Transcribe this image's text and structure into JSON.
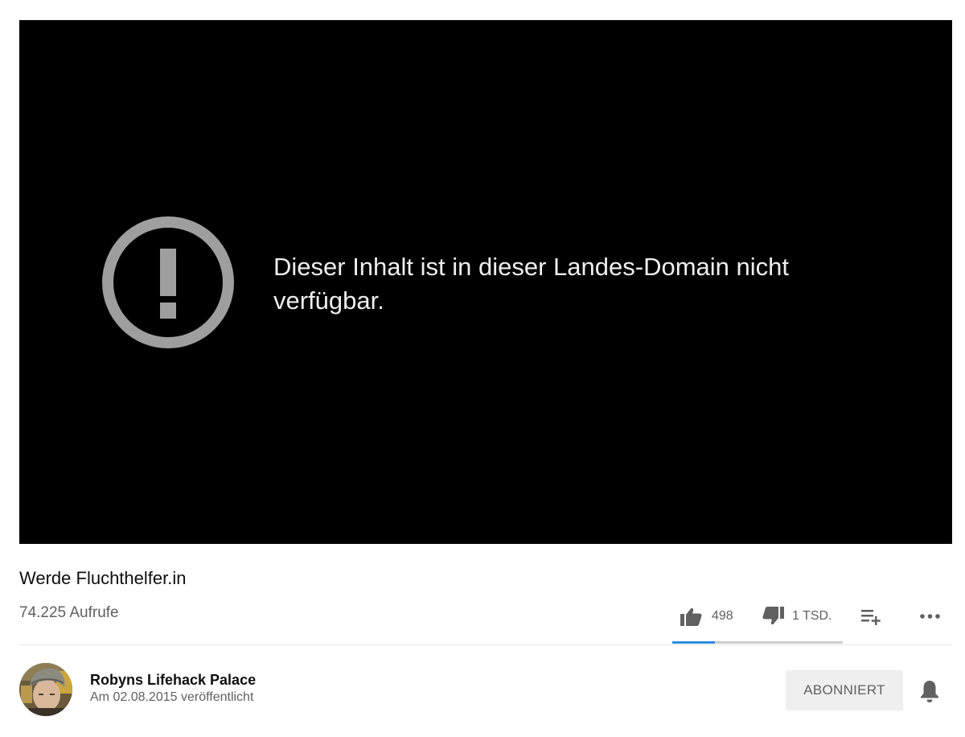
{
  "player": {
    "error_icon": "alert-circle-icon",
    "error_message": "Dieser Inhalt ist in dieser Landes-Domain nicht verfügbar."
  },
  "video": {
    "title": "Werde Fluchthelfer.in",
    "views": "74.225 Aufrufe"
  },
  "actions": {
    "like_icon": "thumbs-up-icon",
    "like_count": "498",
    "dislike_icon": "thumbs-down-icon",
    "dislike_count": "1 TSD.",
    "save_icon": "add-to-playlist-icon",
    "more_icon": "more-horizontal-icon",
    "like_ratio": 0.25
  },
  "channel": {
    "avatar": "channel-avatar",
    "name": "Robyns Lifehack Palace",
    "published": "Am 02.08.2015 veröffentlicht",
    "subscribe_label": "ABONNIERT",
    "bell_icon": "bell-icon"
  },
  "colors": {
    "player_bg": "#000000",
    "error_icon": "#9e9e9e",
    "sentiment_like": "#2f8ee0",
    "sentiment_dislike": "#cccccc",
    "subscribe_bg": "#efefef"
  }
}
